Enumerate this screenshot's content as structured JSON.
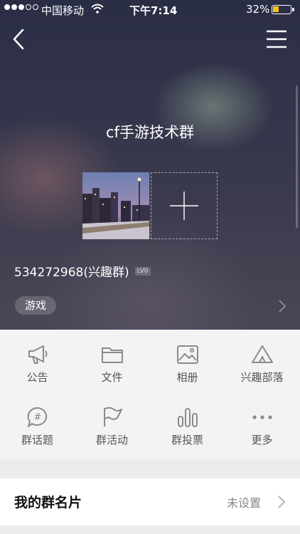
{
  "status_bar": {
    "carrier": "中国移动",
    "time": "下午7:14",
    "battery": "32%"
  },
  "group": {
    "name": "cf手游技术群",
    "id_text": "534272968(兴趣群)",
    "level": "LV0",
    "tag": "游戏"
  },
  "features": [
    {
      "label": "公告",
      "icon": "megaphone-icon"
    },
    {
      "label": "文件",
      "icon": "folder-icon"
    },
    {
      "label": "相册",
      "icon": "photo-album-icon"
    },
    {
      "label": "兴趣部落",
      "icon": "tent-icon"
    },
    {
      "label": "群话题",
      "icon": "topic-bubble-icon"
    },
    {
      "label": "群活动",
      "icon": "flag-icon"
    },
    {
      "label": "群投票",
      "icon": "bar-chart-icon"
    },
    {
      "label": "更多",
      "icon": "more-dots-icon"
    }
  ],
  "card": {
    "title": "我的群名片",
    "value": "未设置"
  },
  "colors": {
    "battery": "#f5c518",
    "icon_gray": "#8a8a8a"
  }
}
